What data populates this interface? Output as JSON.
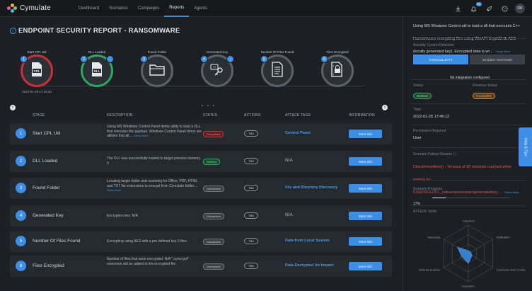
{
  "app": {
    "brand": "Cymulate",
    "nav": [
      "Dashboard",
      "Scenarios",
      "Campaigns",
      "Reports",
      "Agents"
    ],
    "active_nav": "Reports",
    "notification_count": "94",
    "avatar_initials": "DR"
  },
  "page": {
    "title": "ENDPOINT SECURITY REPORT - RANSOMWARE"
  },
  "stages": [
    {
      "num": "1",
      "name": "Start CPL Util",
      "status_color": "red",
      "icon": "cpl-file-icon",
      "date": "2022-01-26 17:46:30",
      "info": false
    },
    {
      "num": "2",
      "name": "DLL Loaded",
      "status_color": "green",
      "icon": "dll-file-icon",
      "date": "",
      "info": true
    },
    {
      "num": "3",
      "name": "Found Folder",
      "status_color": "grey",
      "icon": "folder-icon",
      "date": "",
      "info": false
    },
    {
      "num": "4",
      "name": "Generated Key",
      "status_color": "grey",
      "icon": "key-icon",
      "date": "",
      "info": true
    },
    {
      "num": "5",
      "name": "Number Of Files Found",
      "status_color": "grey",
      "icon": "document-icon",
      "date": "",
      "info": false
    },
    {
      "num": "6",
      "name": "Files Encrypted",
      "status_color": "grey",
      "icon": "encrypted-file-icon",
      "date": "",
      "info": false
    }
  ],
  "table": {
    "headers": {
      "stage": "STAGE",
      "description": "DESCRIPTION",
      "status": "STATUS",
      "actions": "ACTIONS",
      "attack_tags": "ATT&CK TAGS",
      "information": "INFORMATION"
    },
    "rows": [
      {
        "num": "1",
        "stage": "Start CPL Util",
        "desc": "Using MS Windows Control Panel Items utility to load a DLL that executes the payload. Windows Control Panel Items are utilities that all....",
        "show_more": "Show More",
        "status": "Completed",
        "status_type": "completed",
        "action": "TBD",
        "tag": "Control Panel",
        "tag_link": true,
        "button": "More Info"
      },
      {
        "num": "2",
        "stage": "DLL Loaded",
        "desc": "The DLL was successfully loaded to target process memory.\n0",
        "show_more": "",
        "status": "Deleted",
        "status_type": "deleted",
        "action": "TBD",
        "tag": "N/A",
        "tag_link": false,
        "button": "More Info"
      },
      {
        "num": "3",
        "stage": "Found Folder",
        "desc": "Locating target folder and scanning for Office, PDF, HTML and TXT file extensions to encrypt from Cymulate folder....",
        "show_more": "Show More",
        "status": "Unreached",
        "status_type": "unreached",
        "action": "TBD",
        "tag": "File and Directory Discovery",
        "tag_link": true,
        "button": "More Info"
      },
      {
        "num": "4",
        "stage": "Generated Key",
        "desc": "Encryption key: N/A",
        "show_more": "",
        "status": "Unreached",
        "status_type": "unreached",
        "action": "TBD",
        "tag": "N/A",
        "tag_link": false,
        "button": "More Info"
      },
      {
        "num": "5",
        "stage": "Number Of Files Found",
        "desc": "Encrypting using AES with a pre-defined key 0 files.",
        "show_more": "",
        "status": "Unreached",
        "status_type": "unreached",
        "action": "TBD",
        "tag": "Data from Local System",
        "tag_link": true,
        "button": "More Info"
      },
      {
        "num": "6",
        "stage": "Files Encrypted",
        "desc": "Number of files that were encrypted: N/A \".cymcrypt\" extension will be added to the encrypted file.",
        "show_more": "",
        "status": "Unreached",
        "status_type": "unreached",
        "action": "TBD",
        "tag": "Data Encrypted for Impact",
        "tag_link": true,
        "button": "More Info"
      }
    ]
  },
  "right_panel": {
    "summary": "Using MS Windows Control util to load a dll that executes C++ Ransomware encrypting files using WinAPI Crypt32.lib AES (locally generated key). Encrypted data is wr...",
    "summary_more": "Show More",
    "detection_label": "Security Control Detection",
    "tab_events": "EVENTS/ALERTS",
    "tab_incident": "INCIDENT RESPONSE",
    "no_integration": "No integration configured",
    "status_label": "Status",
    "status_value": "Deleted",
    "prev_status_label": "Previous Status",
    "prev_status_value": "Incomplete",
    "time_label": "Time",
    "time_value": "2022-01-26 17:46:12",
    "permission_label": "Permission Required",
    "permission_value": "User",
    "failure_label": "Scenario Failure Reason",
    "failure_value": "CheckkeepAlive() - Timeout of 30 seconds reached while waiting for CONTROLCPL_nativeransomwaregeneratedkey....",
    "failure_more": "Show More",
    "progress_label": "Scenario Progress",
    "progress_text": "17%",
    "progress_value": 0.17,
    "tactic_label": "ATT&CK Tactic",
    "radar_labels": [
      "Collection",
      "Exfiltration",
      "Command And Control",
      "Execution",
      "Defense Evasion",
      "Discovery"
    ],
    "radar_values": [
      0.1,
      0.1,
      0.15,
      0.35,
      0.25,
      0.45
    ],
    "help_tab": "Help & Tips"
  },
  "colors": {
    "accent": "#3d8ee6",
    "red": "#c8313a",
    "green": "#29a85e",
    "grey": "#5c626b",
    "orange": "#d7842c"
  }
}
